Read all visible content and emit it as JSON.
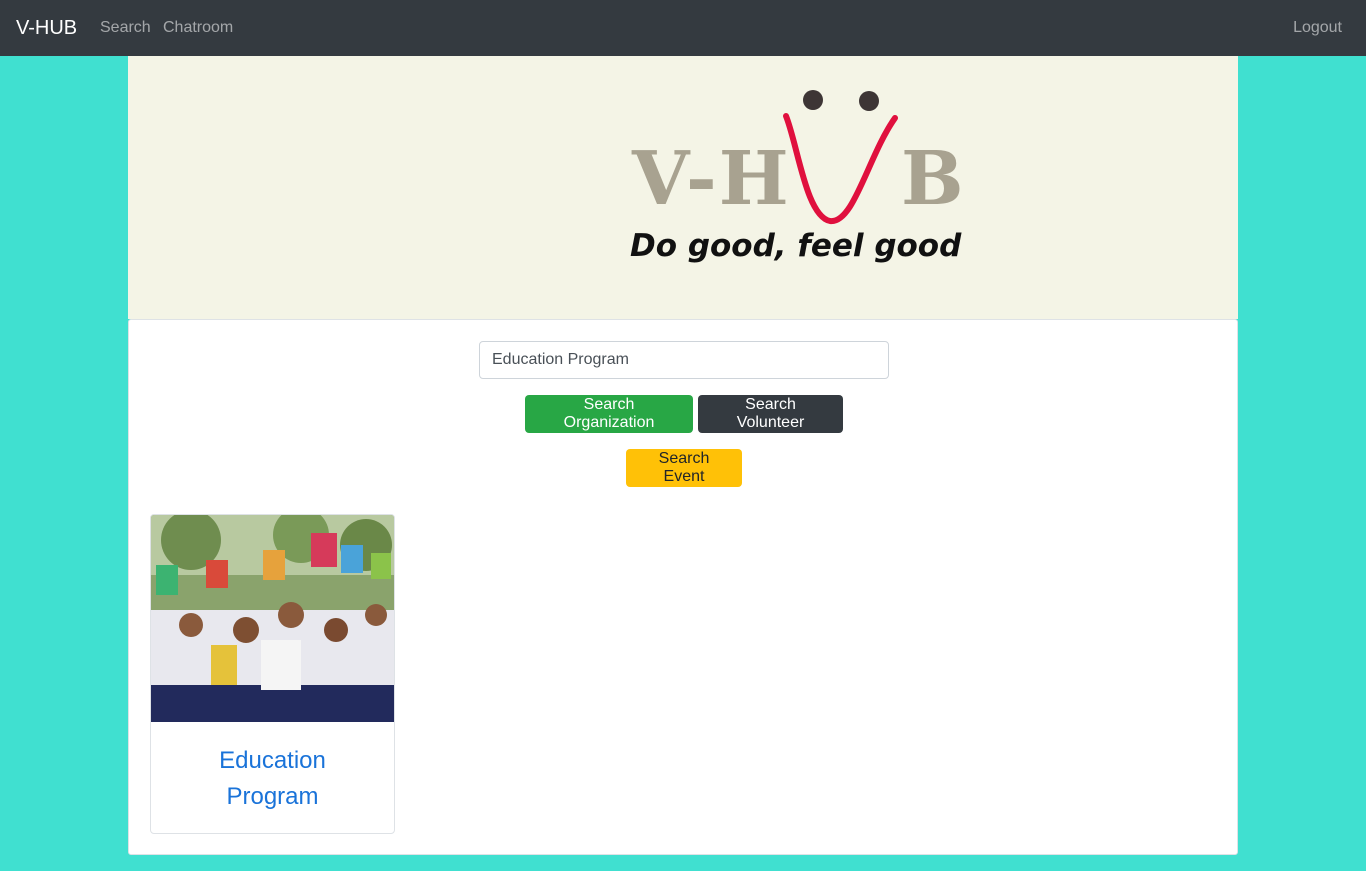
{
  "navbar": {
    "brand": "V-HUB",
    "links": [
      "Search",
      "Chatroom"
    ],
    "logout": "Logout"
  },
  "banner": {
    "logo_text_left": "V-H",
    "logo_text_right": "B",
    "tagline": "Do good, feel good"
  },
  "search": {
    "value": "Education Program",
    "buttons": {
      "organization": "Search Organization",
      "volunteer": "Search Volunteer",
      "event": "Search Event"
    }
  },
  "results": [
    {
      "title_line1": "Education",
      "title_line2": "Program"
    }
  ],
  "colors": {
    "page_bg": "#40e0d0",
    "navbar_bg": "#343a40",
    "banner_bg": "#f4f4e6",
    "btn_org": "#28a745",
    "btn_vol": "#343a40",
    "btn_event": "#ffc107",
    "link": "#1a73d9"
  }
}
